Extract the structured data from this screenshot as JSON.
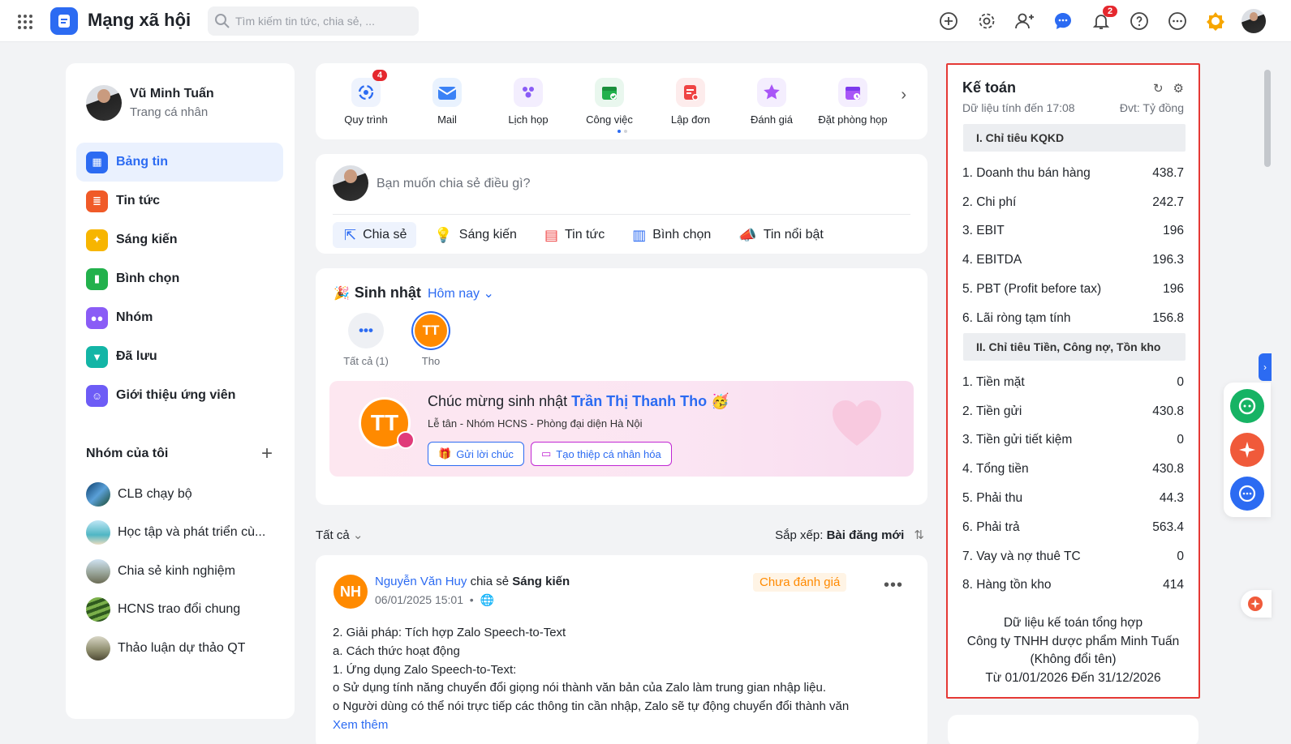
{
  "header": {
    "app_title": "Mạng xã hội",
    "search_placeholder": "Tìm kiếm tin tức, chia sẻ, ...",
    "notification_count": "2"
  },
  "profile": {
    "name": "Vũ Minh Tuấn",
    "subtitle": "Trang cá nhân"
  },
  "sidebar": {
    "items": [
      {
        "label": "Bảng tin",
        "color": "#2c6bf2"
      },
      {
        "label": "Tin tức",
        "color": "#f05a28"
      },
      {
        "label": "Sáng kiến",
        "color": "#f7b500"
      },
      {
        "label": "Bình chọn",
        "color": "#22b14c"
      },
      {
        "label": "Nhóm",
        "color": "#8a5cf6"
      },
      {
        "label": "Đã lưu",
        "color": "#13b5a6"
      },
      {
        "label": "Giới thiệu ứng viên",
        "color": "#6d5cf6"
      }
    ],
    "groups_title": "Nhóm của tôi",
    "groups": [
      "CLB chạy bộ",
      "Học tập và phát triển cù...",
      "Chia sẻ kinh nghiệm",
      "HCNS trao đổi chung",
      "Thảo luận dự thảo QT"
    ]
  },
  "apps": {
    "items": [
      "Quy trình",
      "Mail",
      "Lịch họp",
      "Công việc",
      "Lập đơn",
      "Đánh giá",
      "Đặt phòng họp"
    ],
    "quy_trinh_badge": "4"
  },
  "compose": {
    "placeholder": "Bạn muốn chia sẻ điều gì?",
    "tabs": [
      "Chia sẻ",
      "Sáng kiến",
      "Tin tức",
      "Bình chọn",
      "Tin nổi bật"
    ]
  },
  "birthday": {
    "title": "Sinh nhật",
    "filter": "Hôm nay",
    "all_label": "Tất cả (1)",
    "person_initials": "TT",
    "person_short": "Tho",
    "greeting": "Chúc mừng sinh nhật",
    "person_full": "Trần Thị Thanh Tho",
    "details": "Lễ tân - Nhóm HCNS - Phòng đại diện Hà Nội",
    "btn_wish": "Gửi lời chúc",
    "btn_card": "Tạo thiệp cá nhân hóa"
  },
  "feed": {
    "filter": "Tất cả",
    "sort_label": "Sắp xếp:",
    "sort_value": "Bài đăng mới"
  },
  "post": {
    "initials": "NH",
    "author": "Nguyễn Văn Huy",
    "action": "chia sẻ",
    "category": "Sáng kiến",
    "date": "06/01/2025 15:01",
    "status": "Chưa đánh giá",
    "lines": [
      "2. Giải pháp: Tích hợp Zalo Speech-to-Text",
      "a. Cách thức hoạt động",
      "1. Ứng dụng Zalo Speech-to-Text:",
      "o Sử dụng tính năng chuyển đổi giọng nói thành văn bản của Zalo làm trung gian nhập liệu.",
      "o Người dùng có thể nói trực tiếp các thông tin cần nhập, Zalo sẽ tự động chuyển đổi thành văn"
    ],
    "see_more": "Xem thêm"
  },
  "accounting": {
    "title": "Kế toán",
    "as_of": "Dữ liệu tính đến 17:08",
    "unit": "Đvt: Tỷ đồng",
    "section1": "I. Chỉ tiêu KQKD",
    "rows1": [
      {
        "label": "1. Doanh thu bán hàng",
        "value": "438.7"
      },
      {
        "label": "2. Chi phí",
        "value": "242.7"
      },
      {
        "label": "3. EBIT",
        "value": "196"
      },
      {
        "label": "4. EBITDA",
        "value": "196.3"
      },
      {
        "label": "5. PBT (Profit before tax)",
        "value": "196"
      },
      {
        "label": "6. Lãi ròng tạm tính",
        "value": "156.8"
      }
    ],
    "section2": "II. Chỉ tiêu Tiền, Công nợ, Tồn kho",
    "rows2": [
      {
        "label": "1. Tiền mặt",
        "value": "0"
      },
      {
        "label": "2. Tiền gửi",
        "value": "430.8"
      },
      {
        "label": "3. Tiền gửi tiết kiệm",
        "value": "0"
      },
      {
        "label": "4. Tổng tiền",
        "value": "430.8"
      },
      {
        "label": "5. Phải thu",
        "value": "44.3"
      },
      {
        "label": "6. Phải trả",
        "value": "563.4"
      },
      {
        "label": "7. Vay và nợ thuê TC",
        "value": "0"
      },
      {
        "label": "8. Hàng tồn kho",
        "value": "414"
      }
    ],
    "footer": [
      "Dữ liệu kế toán tổng hợp",
      "Công ty TNHH dược phẩm Minh Tuấn",
      "(Không đổi tên)",
      "Từ 01/01/2026 Đến 31/12/2026"
    ]
  }
}
